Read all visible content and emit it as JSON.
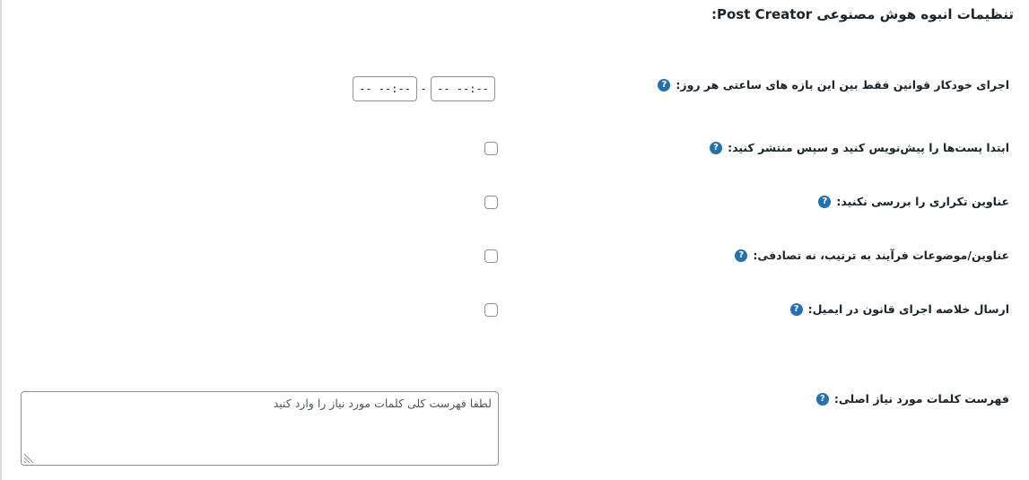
{
  "title": "تنظیمات انبوه هوش مصنوعی Post Creator:",
  "rows": [
    {
      "label": "اجرای خودکار قوانین فقط بین این بازه های ساعتی هر روز:",
      "icon": "help-icon"
    },
    {
      "label": "ابتدا پست‌ها را پیش‌نویس کنید و سپس منتشر کنید:",
      "icon": "help-icon"
    },
    {
      "label": "عناوین تکراری را بررسی نکنید:",
      "icon": "help-icon"
    },
    {
      "label": "عناوین/موضوعات فرآیند به ترتیب، نه تصادفی:",
      "icon": "help-icon"
    },
    {
      "label": "ارسال خلاصه اجرای قانون در ایمیل:",
      "icon": "help-icon"
    },
    {
      "label": "فهرست کلمات مورد نیاز اصلی:",
      "icon": "help-icon"
    }
  ],
  "help_glyph": "?",
  "time_range": {
    "start": "-- --:--",
    "end": "-- --:--",
    "separator": "-"
  },
  "checkboxes": {
    "draft_first": false,
    "skip_duplicate_check": false,
    "sequential_order": false,
    "email_summary": false
  },
  "keywords": {
    "value": "",
    "placeholder": "لطفا فهرست کلی کلمات مورد نیاز را وارد کنید"
  },
  "colors": {
    "help_icon": "#2271b1",
    "input_border": "#8c8f94",
    "text": "#1d2327"
  }
}
